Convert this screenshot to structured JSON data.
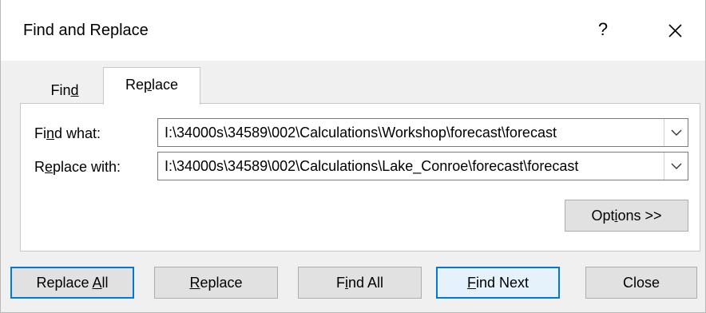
{
  "window": {
    "title": "Find and Replace",
    "help_label": "?",
    "close_icon": "close-icon"
  },
  "tabs": [
    {
      "label_pre": "Fin",
      "label_key": "d",
      "label_post": "",
      "selected": false
    },
    {
      "label_pre": "Re",
      "label_key": "p",
      "label_post": "lace",
      "selected": true
    }
  ],
  "find": {
    "label_pre": "Fi",
    "label_key": "n",
    "label_post": "d what:",
    "value": "I:\\34000s\\34589\\002\\Calculations\\Workshop\\forecast\\forecast"
  },
  "replace": {
    "label_pre": "R",
    "label_key": "e",
    "label_post": "place with:",
    "value": "I:\\34000s\\34589\\002\\Calculations\\Lake_Conroe\\forecast\\forecast"
  },
  "options_button": {
    "pre": "Opt",
    "key": "i",
    "post": "ons >>"
  },
  "buttons": {
    "replace_all": {
      "pre": "Replace ",
      "key": "A",
      "post": "ll"
    },
    "replace": {
      "pre": "",
      "key": "R",
      "post": "eplace"
    },
    "find_all": {
      "pre": "F",
      "key": "i",
      "post": "nd All"
    },
    "find_next": {
      "pre": "",
      "key": "F",
      "post": "ind Next"
    },
    "close": {
      "pre": "Close",
      "key": "",
      "post": ""
    }
  },
  "accent_color": "#0078d7"
}
